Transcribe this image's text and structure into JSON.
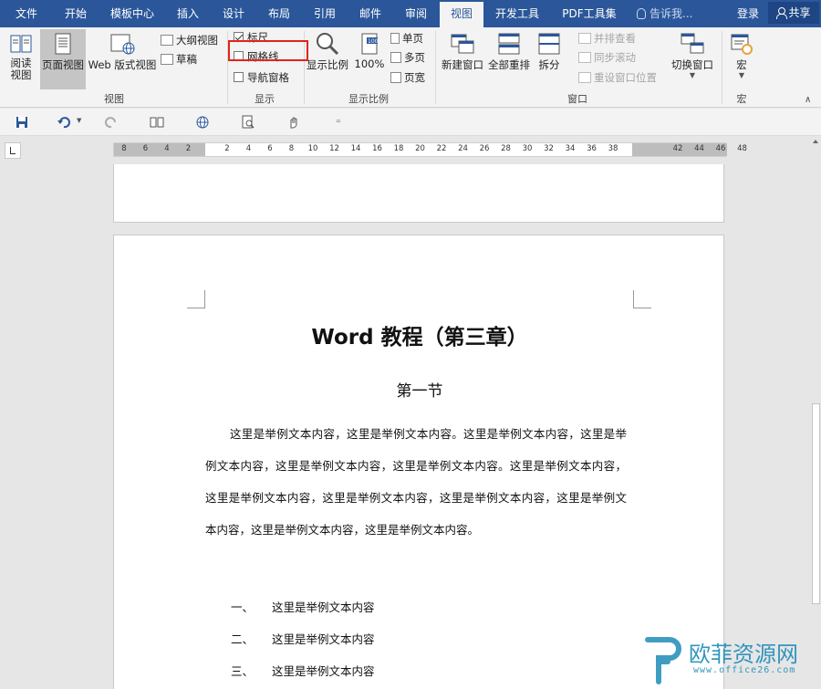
{
  "tabs": [
    "文件",
    "开始",
    "模板中心",
    "插入",
    "设计",
    "布局",
    "引用",
    "邮件",
    "审阅",
    "视图",
    "开发工具",
    "PDF工具集"
  ],
  "active_tab": "视图",
  "tell_me": "告诉我...",
  "login": "登录",
  "share": "共享",
  "ribbon": {
    "views": {
      "read_mode": "阅读\n视图",
      "print_layout": "页面视图",
      "web_layout": "Web 版式视图",
      "outline": "大纲视图",
      "draft": "草稿",
      "label": "视图"
    },
    "show": {
      "ruler": "标尺",
      "gridlines": "网格线",
      "nav_pane": "导航窗格",
      "label": "显示",
      "ruler_checked": true,
      "gridlines_checked": false,
      "nav_pane_checked": false
    },
    "zoom": {
      "zoom": "显示比例",
      "hundred": "100%",
      "one_page": "单页",
      "multi_page": "多页",
      "page_width": "页宽",
      "label": "显示比例"
    },
    "window": {
      "new_window": "新建窗口",
      "arrange_all": "全部重排",
      "split": "拆分",
      "side_by_side": "并排查看",
      "sync_scroll": "同步滚动",
      "reset_position": "重设窗口位置",
      "switch_windows": "切换窗口",
      "label": "窗口"
    },
    "macros": {
      "macros": "宏",
      "label": "宏"
    }
  },
  "ruler_numbers": [
    "8",
    "6",
    "4",
    "2",
    "2",
    "4",
    "6",
    "8",
    "10",
    "12",
    "14",
    "16",
    "18",
    "20",
    "22",
    "24",
    "26",
    "28",
    "30",
    "32",
    "34",
    "36",
    "38",
    "42",
    "44",
    "46",
    "48"
  ],
  "document": {
    "title": "Word 教程（第三章）",
    "subtitle": "第一节",
    "paragraph": "这里是举例文本内容，这里是举例文本内容。这里是举例文本内容，这里是举例文本内容，这里是举例文本内容，这里是举例文本内容。这里是举例文本内容，这里是举例文本内容，这里是举例文本内容，这里是举例文本内容，这里是举例文本内容，这里是举例文本内容，这里是举例文本内容。",
    "list": [
      {
        "mark": "一、",
        "text": "这里是举例文本内容"
      },
      {
        "mark": "二、",
        "text": "这里是举例文本内容"
      },
      {
        "mark": "三、",
        "text": "这里是举例文本内容"
      }
    ]
  },
  "watermark": {
    "text": "欧菲资源网",
    "url": "www.office26.com"
  },
  "colors": {
    "accent": "#2b579a",
    "highlight_box": "#e2231a",
    "watermark": "#1f8cb8"
  }
}
